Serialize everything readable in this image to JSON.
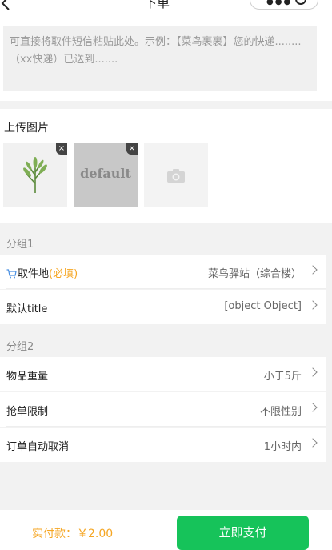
{
  "header": {
    "title": "下单"
  },
  "paste": {
    "placeholder": "可直接将取件短信粘贴此处。示例：【菜鸟裹裹】您的快递........（xx快递）已送到......."
  },
  "upload": {
    "title": "上传图片",
    "default_image_text": "default",
    "delete_glyph": "×"
  },
  "group1": {
    "title": "分组1",
    "rows": [
      {
        "label": "取件地",
        "required_tag": "(必填)",
        "value": "菜鸟驿站（综合楼）"
      },
      {
        "label": "默认title",
        "value": "[object Object]"
      }
    ]
  },
  "group2": {
    "title": "分组2",
    "rows": [
      {
        "label": "物品重量",
        "value": "小于5斤"
      },
      {
        "label": "抢单限制",
        "value": "不限性别"
      },
      {
        "label": "订单自动取消",
        "value": "1小时内"
      }
    ]
  },
  "footer": {
    "amount_label": "实付款：￥2.00",
    "pay_button": "立即支付"
  },
  "colors": {
    "accent": "#f5a623",
    "pay_button": "#16c35a",
    "cart_icon": "#4a90e2"
  }
}
